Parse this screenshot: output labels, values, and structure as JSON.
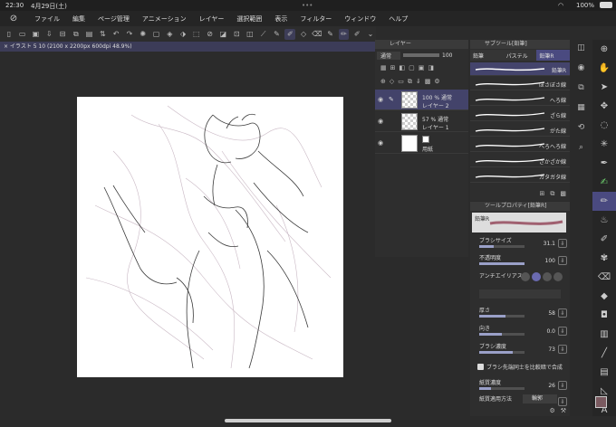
{
  "status": {
    "time": "22:30",
    "date": "4月29日(土)",
    "battery": "100%",
    "dots": "•••"
  },
  "menu": {
    "items": [
      "ファイル",
      "編集",
      "ページ管理",
      "アニメーション",
      "レイヤー",
      "選択範囲",
      "表示",
      "フィルター",
      "ウィンドウ",
      "ヘルプ"
    ]
  },
  "tab": {
    "title": "×  イラスト 5 10 (2100 x 2200px 600dpi 48.9%)"
  },
  "layers": {
    "title": "レイヤー",
    "blend": "通常",
    "opacity": "100",
    "rows": [
      {
        "line1": "100 %  通常",
        "line2": "レイヤー 2",
        "selected": true
      },
      {
        "line1": "57 %  通常",
        "line2": "レイヤー 1",
        "selected": false
      },
      {
        "line1": "",
        "line2": "用紙",
        "selected": false
      }
    ]
  },
  "subtool": {
    "title": "サブツール[鉛筆]",
    "tabs": [
      "鉛筆",
      "パステル",
      "鉛筆R"
    ],
    "selected_name": "鉛筆R",
    "brushes": [
      "ぼさぼさ線",
      "へろ線",
      "ざら線",
      "がた線",
      "へろへろ線",
      "ざかざか線",
      "ガタガタ線"
    ]
  },
  "props": {
    "title": "ツールプロパティ[鉛筆R]",
    "preview_name": "鉛筆R",
    "brush_size_label": "ブラシサイズ",
    "brush_size": "31.1",
    "opacity_label": "不透明度",
    "opacity": "100",
    "aa_label": "アンチエイリアス",
    "thickness_label": "厚さ",
    "thickness": "58",
    "direction_label": "向き",
    "direction": "0.0",
    "density_label": "ブラシ濃度",
    "density": "73",
    "compare_label": "ブラシ先端同士を比較暗で合成",
    "paper_density_label": "紙質濃度",
    "paper_density": "26",
    "paper_method_label": "紙質適用方法",
    "paper_method": "輪郭",
    "bars": {
      "brush_size": 0.31,
      "opacity": 1.0,
      "thickness": 0.58,
      "direction": 0.5,
      "density": 0.73,
      "paper_density": 0.26
    }
  },
  "colors": {
    "accent": "#4a4a80",
    "selection": "#43436a",
    "paper": "#ffffff",
    "main_color": "#7a5a60"
  }
}
